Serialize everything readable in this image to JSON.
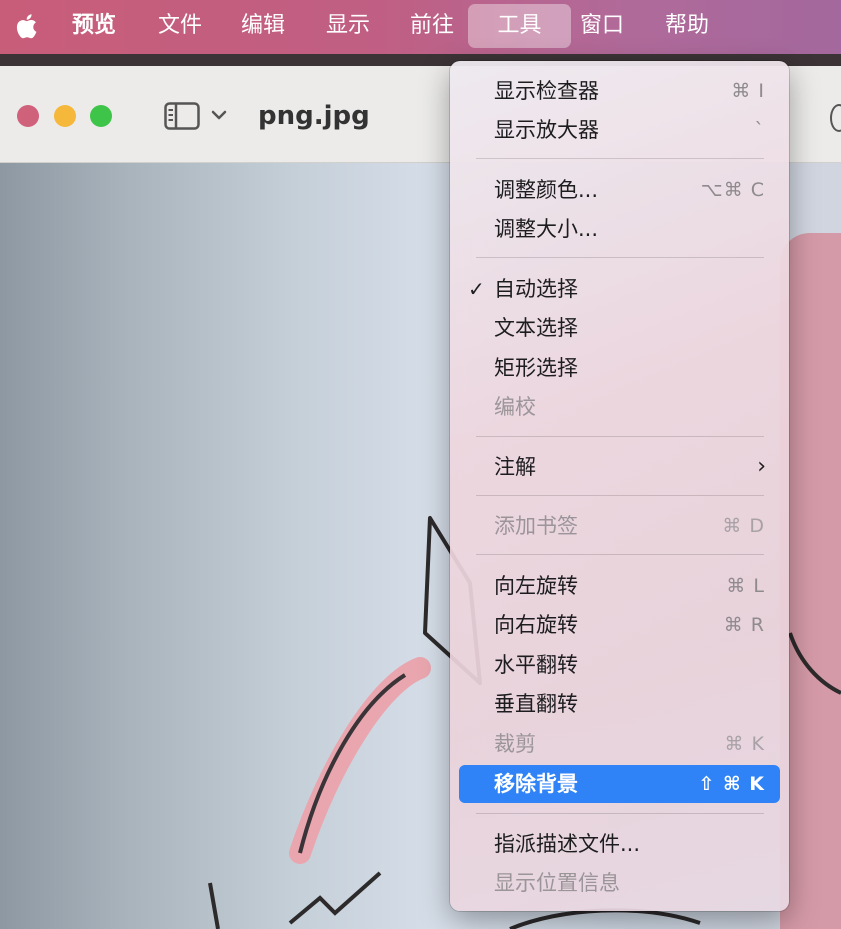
{
  "menubar": {
    "items": [
      {
        "label": "预览"
      },
      {
        "label": "文件"
      },
      {
        "label": "编辑"
      },
      {
        "label": "显示"
      },
      {
        "label": "前往"
      },
      {
        "label": "工具"
      },
      {
        "label": "窗口"
      },
      {
        "label": "帮助"
      }
    ],
    "active": "工具"
  },
  "window": {
    "title": "png.jpg",
    "traffic_lights": {
      "close": "#ed6a5e",
      "minimize": "#f5bf4f",
      "zoom": "#61c554"
    }
  },
  "tools_menu": {
    "items": [
      {
        "label": "显示检查器",
        "shortcut": "⌘ I"
      },
      {
        "label": "显示放大器",
        "shortcut": "`"
      },
      {
        "label": "调整颜色...",
        "shortcut": "⌥⌘ C"
      },
      {
        "label": "调整大小..."
      },
      {
        "label": "自动选择",
        "checked": true,
        "check": "✓"
      },
      {
        "label": "文本选择"
      },
      {
        "label": "矩形选择"
      },
      {
        "label": "编校",
        "disabled": true
      },
      {
        "label": "注解",
        "submenu": "›"
      },
      {
        "label": "添加书签",
        "shortcut": "⌘ D",
        "disabled": true
      },
      {
        "label": "向左旋转",
        "shortcut": "⌘ L"
      },
      {
        "label": "向右旋转",
        "shortcut": "⌘ R"
      },
      {
        "label": "水平翻转"
      },
      {
        "label": "垂直翻转"
      },
      {
        "label": "裁剪",
        "shortcut": "⌘ K",
        "disabled": true
      },
      {
        "label": "移除背景",
        "shortcut": "⇧ ⌘ K",
        "highlighted": true
      },
      {
        "label": "指派描述文件..."
      },
      {
        "label": "显示位置信息",
        "disabled": true
      }
    ]
  },
  "icons": [
    "apple-logo-icon",
    "sidebar-toggle-icon",
    "chevron-down-icon",
    "checkmark-icon",
    "chevron-right-icon"
  ],
  "colors": {
    "highlight": "#2f83f6",
    "menubar": "#c05f83"
  }
}
